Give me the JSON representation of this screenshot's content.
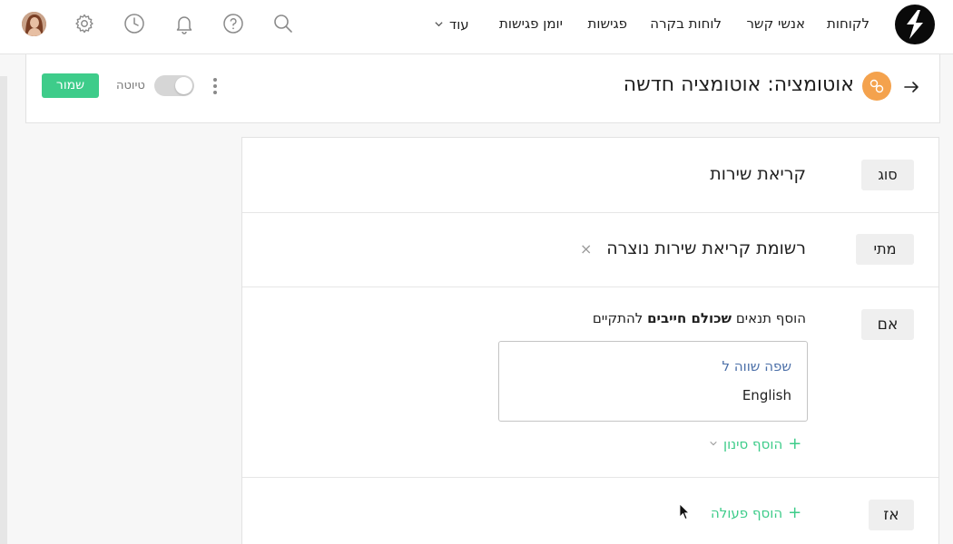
{
  "topnav": {
    "items": [
      {
        "label": "לקוחות"
      },
      {
        "label": "אנשי קשר"
      },
      {
        "label": "לוחות בקרה"
      },
      {
        "label": "פגישות"
      },
      {
        "label": "יומן פגישות"
      }
    ],
    "more_label": "עוד",
    "icons": [
      "search-icon",
      "help-icon",
      "bell-icon",
      "clock-icon",
      "gear-icon",
      "avatar"
    ]
  },
  "header": {
    "title": "אוטומציה: אוטומציה חדשה",
    "draft_label": "טיוטה",
    "save_label": "שמור",
    "draft_toggle_on": false
  },
  "rule": {
    "type": {
      "tag": "סוג",
      "value": "קריאת שירות"
    },
    "when": {
      "tag": "מתי",
      "value": "רשומת קריאת שירות נוצרה",
      "clear": "×"
    },
    "if": {
      "tag": "אם",
      "intro_before": "הוסף תנאים",
      "intro_bold": "שכולם חייבים",
      "intro_after": "להתקיים",
      "filter": {
        "field": "שפה שווה ל",
        "value": "English"
      },
      "add_filter": "הוסף סינון"
    },
    "then": {
      "tag": "אז",
      "add_action": "הוסף פעולה"
    }
  },
  "colors": {
    "accent_green": "#3ecc8a",
    "filter_field_blue": "#4b6fa8",
    "automation_icon_orange": "#f4a24d"
  }
}
